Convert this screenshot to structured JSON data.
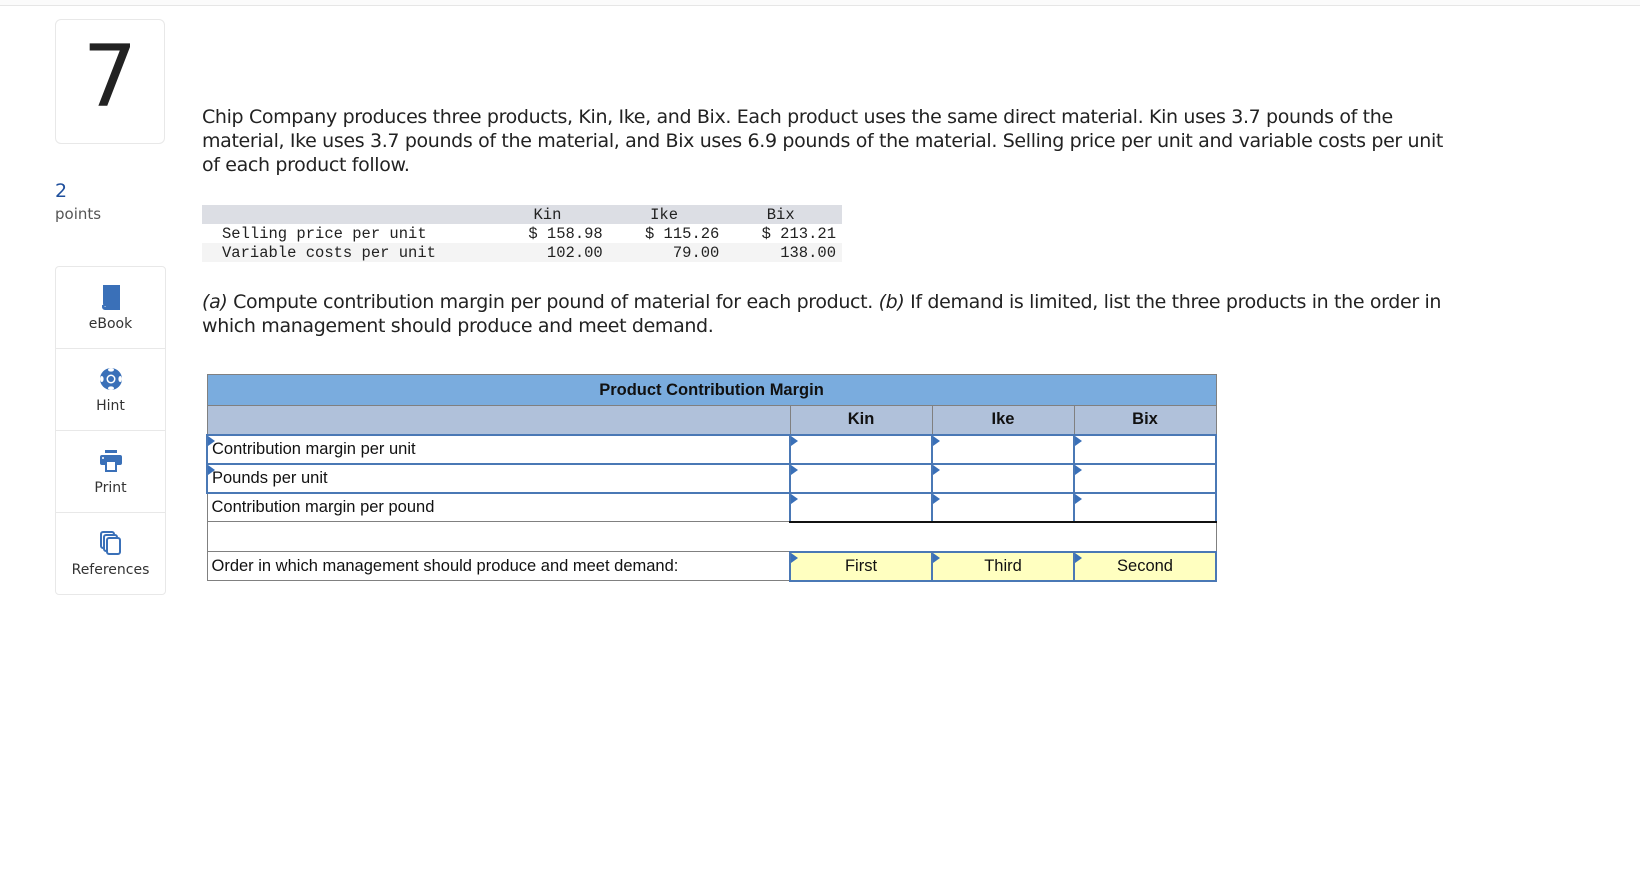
{
  "question": {
    "number": "7",
    "points_value": "2",
    "points_label": "points"
  },
  "tools": [
    {
      "label": "eBook",
      "icon": "book-icon"
    },
    {
      "label": "Hint",
      "icon": "lifebuoy-icon"
    },
    {
      "label": "Print",
      "icon": "printer-icon"
    },
    {
      "label": "References",
      "icon": "documents-icon"
    }
  ],
  "intro": "Chip Company produces three products, Kin, Ike, and Bix. Each product uses the same direct material. Kin uses 3.7 pounds of the material, Ike uses 3.7 pounds of the material, and Bix uses 6.9 pounds of the material. Selling price per unit and variable costs per unit of each product follow.",
  "given_table": {
    "headers": [
      "",
      "Kin",
      "Ike",
      "Bix"
    ],
    "rows": [
      {
        "label": "Selling price per unit",
        "values": [
          "$ 158.98",
          "$ 115.26",
          "$ 213.21"
        ]
      },
      {
        "label": "Variable costs per unit",
        "values": [
          "102.00",
          "79.00",
          "138.00"
        ]
      }
    ]
  },
  "task": {
    "a_label": "(a)",
    "a_text": " Compute contribution margin per pound of material for each product. ",
    "b_label": "(b)",
    "b_text": " If demand is limited, list the three products in the order in which management should produce and meet demand."
  },
  "worksheet": {
    "title": "Product Contribution Margin",
    "columns": [
      "Kin",
      "Ike",
      "Bix"
    ],
    "rows": [
      {
        "label": "Contribution margin per unit",
        "values": [
          "",
          "",
          ""
        ]
      },
      {
        "label": "Pounds per unit",
        "values": [
          "",
          "",
          ""
        ]
      },
      {
        "label": "Contribution margin per pound",
        "values": [
          "",
          "",
          ""
        ]
      }
    ],
    "order_row": {
      "label": "Order in which management should produce and meet demand:",
      "values": [
        "First",
        "Third",
        "Second"
      ]
    }
  },
  "colors": {
    "accent": "#3a70b8",
    "title_bg": "#7aacde",
    "header_bg": "#b0c1da",
    "select_bg": "#ffffc0"
  }
}
